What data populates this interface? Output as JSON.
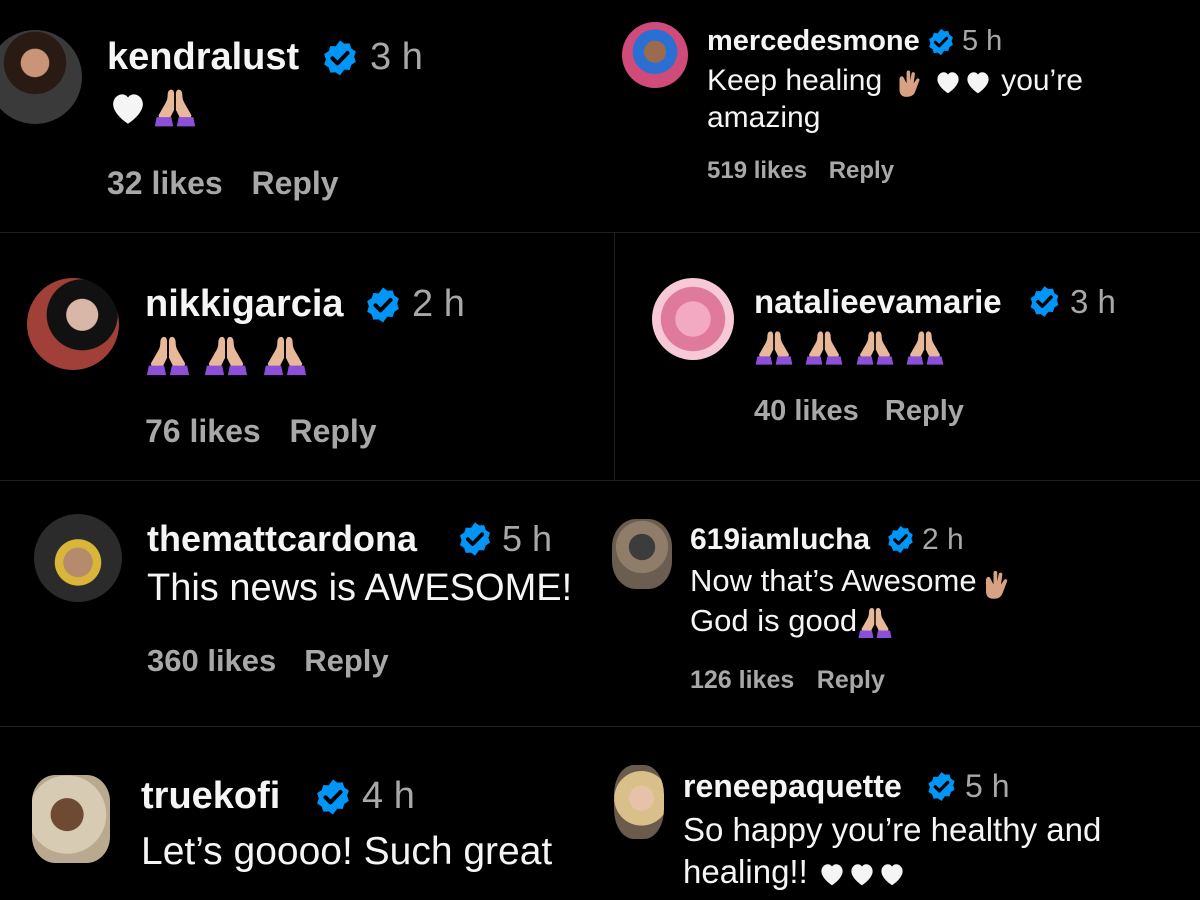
{
  "colors": {
    "verified": "#0095f6",
    "muted": "#a8a8a8",
    "text": "#f5f5f5",
    "pray": "#8b4fd8",
    "skin": "#e8b89a"
  },
  "comments": [
    {
      "username": "kendralust",
      "time": "3 h",
      "likes": "32 likes",
      "reply": "Reply"
    },
    {
      "username": "mercedesmone",
      "time": "5 h",
      "text1": "Keep healing",
      "text2": "you’re",
      "text3": "amazing",
      "likes": "519 likes",
      "reply": "Reply"
    },
    {
      "username": "nikkigarcia",
      "time": "2 h",
      "likes": "76 likes",
      "reply": "Reply"
    },
    {
      "username": "natalieevamarie",
      "time": "3 h",
      "likes": "40 likes",
      "reply": "Reply"
    },
    {
      "username": "themattcardona",
      "time": "5 h",
      "text1": "This news is AWESOME!",
      "likes": "360 likes",
      "reply": "Reply"
    },
    {
      "username": "619iamlucha",
      "time": "2 h",
      "text1": "Now that’s Awesome",
      "text2": "God is good",
      "likes": "126 likes",
      "reply": "Reply"
    },
    {
      "username": "truekofi",
      "time": "4 h",
      "text1": "Let’s goooo! Such great"
    },
    {
      "username": "reneepaquette",
      "time": "5 h",
      "text1": "So happy you’re healthy and",
      "text2": "healing!!"
    }
  ]
}
